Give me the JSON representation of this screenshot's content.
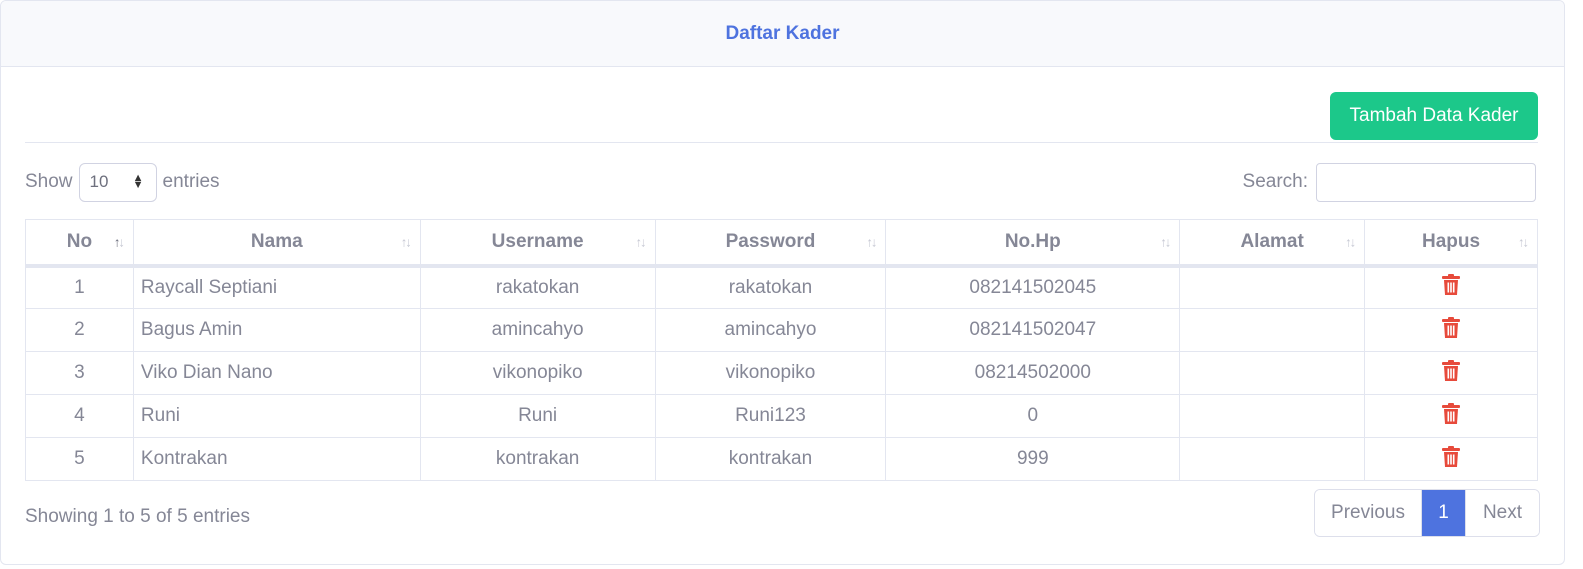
{
  "header": {
    "title": "Daftar Kader"
  },
  "toolbar": {
    "add_label": "Tambah Data Kader"
  },
  "length": {
    "show_label": "Show",
    "value": "10",
    "entries_label": "entries"
  },
  "search": {
    "label": "Search:",
    "value": "",
    "placeholder": ""
  },
  "table": {
    "columns": [
      "No",
      "Nama",
      "Username",
      "Password",
      "No.Hp",
      "Alamat",
      "Hapus"
    ],
    "rows": [
      {
        "no": "1",
        "nama": "Raycall Septiani",
        "username": "rakatokan",
        "password": "rakatokan",
        "hp": "082141502045",
        "alamat": ""
      },
      {
        "no": "2",
        "nama": "Bagus Amin",
        "username": "amincahyo",
        "password": "amincahyo",
        "hp": "082141502047",
        "alamat": ""
      },
      {
        "no": "3",
        "nama": "Viko Dian Nano",
        "username": "vikonopiko",
        "password": "vikonopiko",
        "hp": "08214502000",
        "alamat": ""
      },
      {
        "no": "4",
        "nama": "Runi",
        "username": "Runi",
        "password": "Runi123",
        "hp": "0",
        "alamat": ""
      },
      {
        "no": "5",
        "nama": "Kontrakan",
        "username": "kontrakan",
        "password": "kontrakan",
        "hp": "999",
        "alamat": ""
      }
    ]
  },
  "footer": {
    "info": "Showing 1 to 5 of 5 entries"
  },
  "pagination": {
    "previous": "Previous",
    "current": "1",
    "next": "Next"
  },
  "icons": {
    "sort": "sort-icon",
    "delete": "trash-icon",
    "select": "updown-icon"
  },
  "colors": {
    "primary": "#4e73df",
    "success": "#1cc88a",
    "danger": "#e74a3b",
    "text": "#858796"
  }
}
